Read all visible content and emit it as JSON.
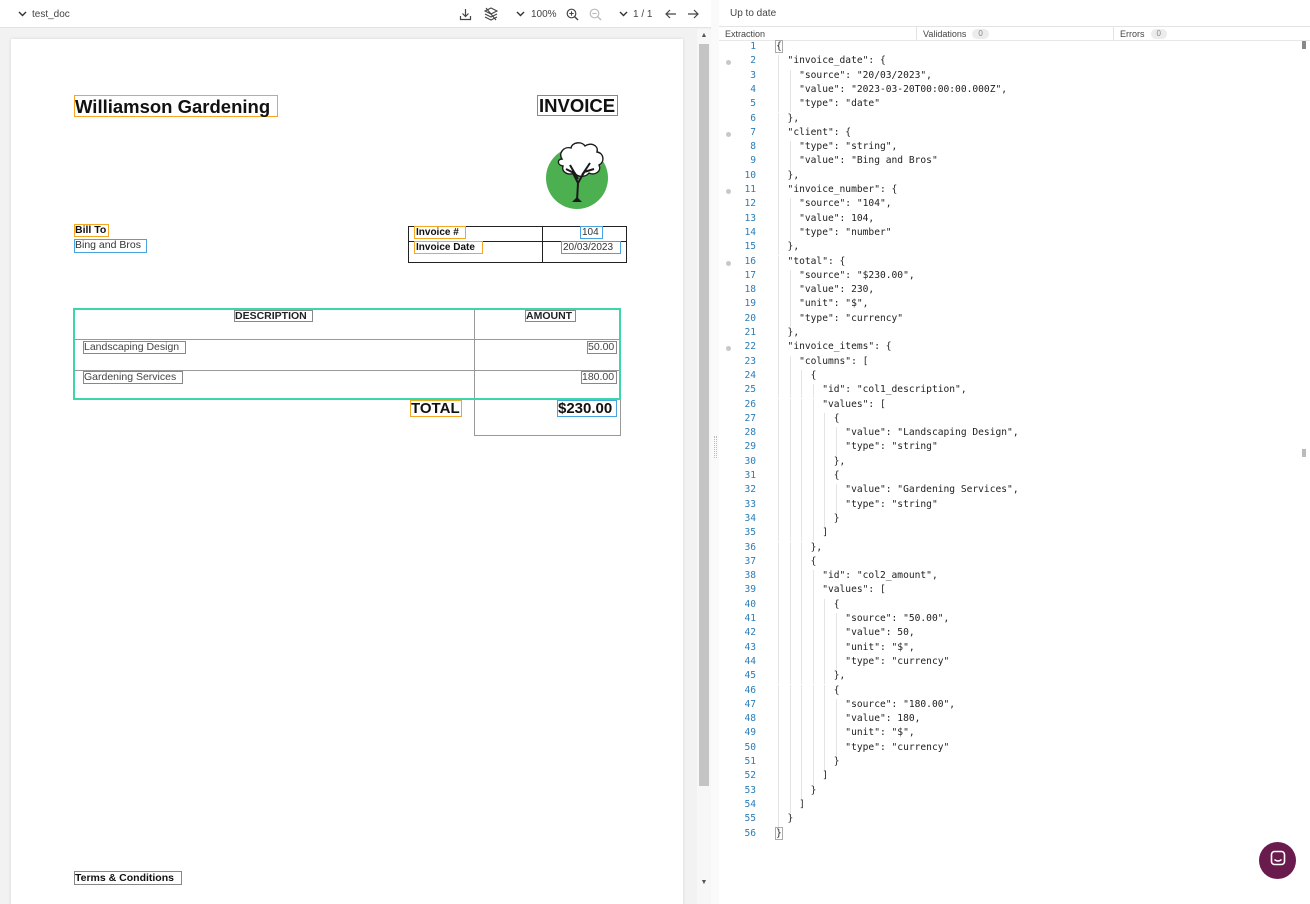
{
  "toolbar": {
    "doc_name": "test_doc",
    "zoom": "100%",
    "page_indicator": "1 / 1"
  },
  "document": {
    "company": "Williamson Gardening",
    "heading": "INVOICE",
    "bill_to_label": "Bill To",
    "bill_to_value": "Bing and Bros",
    "invoice_number_label": "Invoice #",
    "invoice_number_value": "104",
    "invoice_date_label": "Invoice Date",
    "invoice_date_value": "20/03/2023",
    "table_header_description": "DESCRIPTION",
    "table_header_amount": "AMOUNT",
    "items": [
      {
        "description": "Landscaping Design",
        "amount": "50.00"
      },
      {
        "description": "Gardening Services",
        "amount": "180.00"
      }
    ],
    "total_label": "TOTAL",
    "total_value": "$230.00",
    "terms": "Terms & Conditions"
  },
  "right_panel": {
    "status": "Up to date",
    "tabs": [
      {
        "label": "Extraction",
        "count": ""
      },
      {
        "label": "Validations",
        "count": "0"
      },
      {
        "label": "Errors",
        "count": "0"
      }
    ]
  },
  "json_lines": [
    {
      "n": "1",
      "text": "{",
      "fold": false
    },
    {
      "n": "2",
      "text": "  \"invoice_date\": {",
      "fold": true
    },
    {
      "n": "3",
      "text": "    \"source\": \"20/03/2023\",",
      "fold": false
    },
    {
      "n": "4",
      "text": "    \"value\": \"2023-03-20T00:00:00.000Z\",",
      "fold": false
    },
    {
      "n": "5",
      "text": "    \"type\": \"date\"",
      "fold": false
    },
    {
      "n": "6",
      "text": "  },",
      "fold": false
    },
    {
      "n": "7",
      "text": "  \"client\": {",
      "fold": true
    },
    {
      "n": "8",
      "text": "    \"type\": \"string\",",
      "fold": false
    },
    {
      "n": "9",
      "text": "    \"value\": \"Bing and Bros\"",
      "fold": false
    },
    {
      "n": "10",
      "text": "  },",
      "fold": false
    },
    {
      "n": "11",
      "text": "  \"invoice_number\": {",
      "fold": true
    },
    {
      "n": "12",
      "text": "    \"source\": \"104\",",
      "fold": false
    },
    {
      "n": "13",
      "text": "    \"value\": 104,",
      "fold": false
    },
    {
      "n": "14",
      "text": "    \"type\": \"number\"",
      "fold": false
    },
    {
      "n": "15",
      "text": "  },",
      "fold": false
    },
    {
      "n": "16",
      "text": "  \"total\": {",
      "fold": true
    },
    {
      "n": "17",
      "text": "    \"source\": \"$230.00\",",
      "fold": false
    },
    {
      "n": "18",
      "text": "    \"value\": 230,",
      "fold": false
    },
    {
      "n": "19",
      "text": "    \"unit\": \"$\",",
      "fold": false
    },
    {
      "n": "20",
      "text": "    \"type\": \"currency\"",
      "fold": false
    },
    {
      "n": "21",
      "text": "  },",
      "fold": false
    },
    {
      "n": "22",
      "text": "  \"invoice_items\": {",
      "fold": true
    },
    {
      "n": "23",
      "text": "    \"columns\": [",
      "fold": false
    },
    {
      "n": "24",
      "text": "      {",
      "fold": false
    },
    {
      "n": "25",
      "text": "        \"id\": \"col1_description\",",
      "fold": false
    },
    {
      "n": "26",
      "text": "        \"values\": [",
      "fold": false
    },
    {
      "n": "27",
      "text": "          {",
      "fold": false
    },
    {
      "n": "28",
      "text": "            \"value\": \"Landscaping Design\",",
      "fold": false
    },
    {
      "n": "29",
      "text": "            \"type\": \"string\"",
      "fold": false
    },
    {
      "n": "30",
      "text": "          },",
      "fold": false
    },
    {
      "n": "31",
      "text": "          {",
      "fold": false
    },
    {
      "n": "32",
      "text": "            \"value\": \"Gardening Services\",",
      "fold": false
    },
    {
      "n": "33",
      "text": "            \"type\": \"string\"",
      "fold": false
    },
    {
      "n": "34",
      "text": "          }",
      "fold": false
    },
    {
      "n": "35",
      "text": "        ]",
      "fold": false
    },
    {
      "n": "36",
      "text": "      },",
      "fold": false
    },
    {
      "n": "37",
      "text": "      {",
      "fold": false
    },
    {
      "n": "38",
      "text": "        \"id\": \"col2_amount\",",
      "fold": false
    },
    {
      "n": "39",
      "text": "        \"values\": [",
      "fold": false
    },
    {
      "n": "40",
      "text": "          {",
      "fold": false
    },
    {
      "n": "41",
      "text": "            \"source\": \"50.00\",",
      "fold": false
    },
    {
      "n": "42",
      "text": "            \"value\": 50,",
      "fold": false
    },
    {
      "n": "43",
      "text": "            \"unit\": \"$\",",
      "fold": false
    },
    {
      "n": "44",
      "text": "            \"type\": \"currency\"",
      "fold": false
    },
    {
      "n": "45",
      "text": "          },",
      "fold": false
    },
    {
      "n": "46",
      "text": "          {",
      "fold": false
    },
    {
      "n": "47",
      "text": "            \"source\": \"180.00\",",
      "fold": false
    },
    {
      "n": "48",
      "text": "            \"value\": 180,",
      "fold": false
    },
    {
      "n": "49",
      "text": "            \"unit\": \"$\",",
      "fold": false
    },
    {
      "n": "50",
      "text": "            \"type\": \"currency\"",
      "fold": false
    },
    {
      "n": "51",
      "text": "          }",
      "fold": false
    },
    {
      "n": "52",
      "text": "        ]",
      "fold": false
    },
    {
      "n": "53",
      "text": "      }",
      "fold": false
    },
    {
      "n": "54",
      "text": "    ]",
      "fold": false
    },
    {
      "n": "55",
      "text": "  }",
      "fold": false
    },
    {
      "n": "56",
      "text": "}",
      "fold": false
    }
  ],
  "colors": {
    "field_box": "#f5a623",
    "value_box": "#4aa3df",
    "table_box": "#3cd6a8",
    "line_number": "#2a7db8",
    "chat_button": "#6a1b4d",
    "tree_circle": "#4caf50"
  },
  "icons": [
    "chevron-down-icon",
    "download-icon",
    "layers-icon",
    "zoom-in-icon",
    "zoom-out-icon",
    "arrow-left-icon",
    "arrow-right-icon",
    "chat-icon",
    "tree-logo"
  ]
}
